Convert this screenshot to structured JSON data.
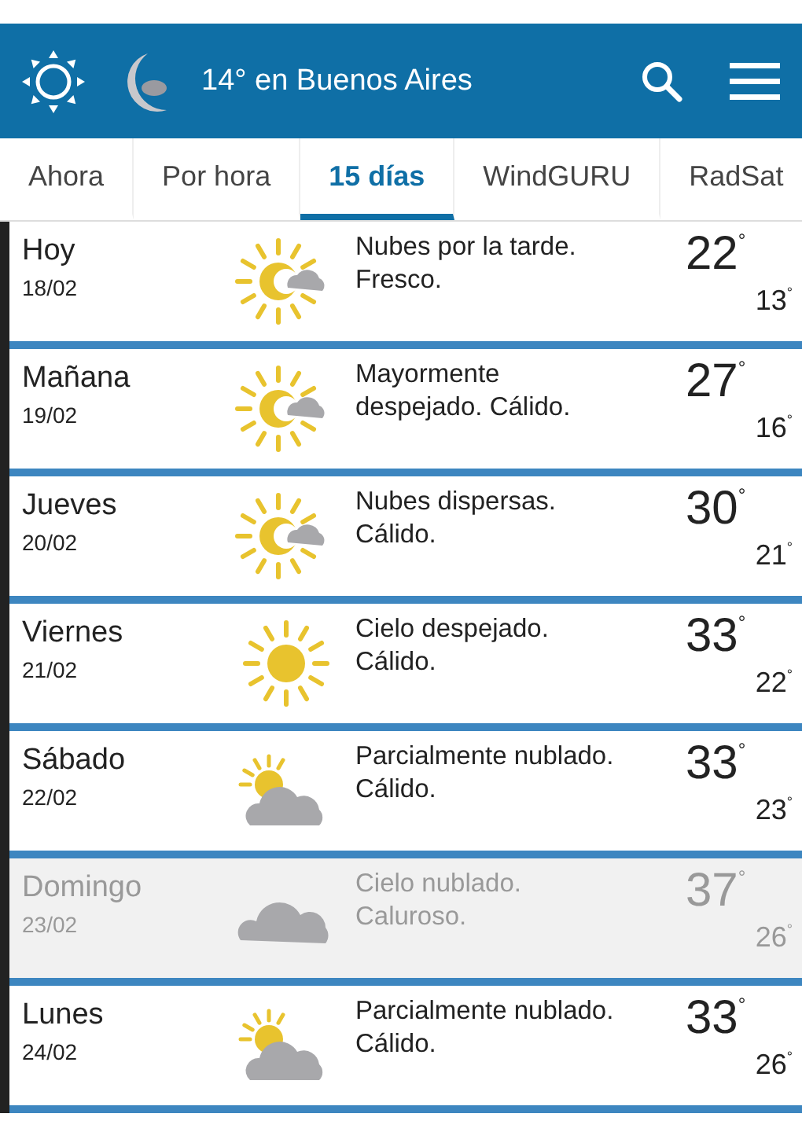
{
  "header": {
    "title": "14° en Buenos Aires"
  },
  "tabs": [
    {
      "label": "Ahora",
      "selected": false
    },
    {
      "label": "Por hora",
      "selected": false
    },
    {
      "label": "15 días",
      "selected": true
    },
    {
      "label": "WindGURU",
      "selected": false
    },
    {
      "label": "RadSat",
      "selected": false
    }
  ],
  "days": [
    {
      "day": "Hoy",
      "date": "18/02",
      "kind": "sun-cloud",
      "summary": "Nubes por la tarde. Fresco.",
      "high": "22$^{°}$",
      "low": "13$^{°}$",
      "highlighted": false
    },
    {
      "day": "Mañana",
      "date": "19/02",
      "kind": "sun-cloud",
      "summary": "Mayormente despejado. Cálido.",
      "high": "27$^{°}$",
      "low": "16$^{°}$",
      "highlighted": false
    },
    {
      "day": "Jueves",
      "date": "20/02",
      "kind": "sun-cloud",
      "summary": "Nubes dispersas. Cálido.",
      "high": "30$^{°}$",
      "low": "21$^{°}$",
      "highlighted": false
    },
    {
      "day": "Viernes",
      "date": "21/02",
      "kind": "sun",
      "summary": "Cielo despejado. Cálido.",
      "high": "33$^{°}$",
      "low": "22$^{°}$",
      "highlighted": false
    },
    {
      "day": "Sábado",
      "date": "22/02",
      "kind": "partly-cloudy",
      "summary": "Parcialmente nublado. Cálido.",
      "high": "33$^{°}$",
      "low": "23$^{°}$",
      "highlighted": false
    },
    {
      "day": "Domingo",
      "date": "23/02",
      "kind": "cloudy",
      "summary": "Cielo nublado. Caluroso.",
      "high": "37$^{°}$",
      "low": "26$^{°}$",
      "highlighted": true
    },
    {
      "day": "Lunes",
      "date": "24/02",
      "kind": "partly-cloudy",
      "summary": "Parcialmente nublado. Cálido.",
      "high": "33$^{°}$",
      "low": "26$^{°}$",
      "highlighted": false
    }
  ]
}
